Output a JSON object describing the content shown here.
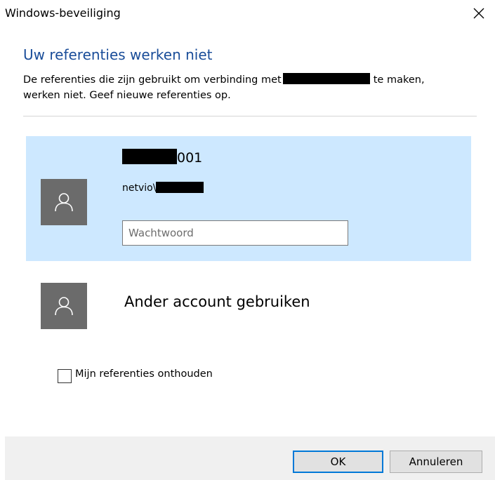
{
  "window": {
    "title": "Windows-beveiliging",
    "close_icon": "close-icon"
  },
  "header": {
    "heading": "Uw referenties werken niet",
    "desc_part1": "De referenties die zijn gebruikt om verbinding met",
    "desc_part2": "te maken, werken niet. Geef nieuwe referenties op."
  },
  "accounts": {
    "selected": {
      "name_suffix": "001",
      "user_prefix": "netvio\\",
      "password_placeholder": "Wachtwoord",
      "avatar_icon": "user-icon"
    },
    "other": {
      "label": "Ander account gebruiken",
      "avatar_icon": "user-icon"
    }
  },
  "remember": {
    "label": "Mijn referenties onthouden",
    "checked": false
  },
  "buttons": {
    "ok": "OK",
    "cancel": "Annuleren"
  },
  "colors": {
    "heading": "#1a4d99",
    "selected_bg": "#cde8ff",
    "avatar_bg": "#6b6b6b",
    "footer_bg": "#f0f0f0",
    "focus_border": "#0078d7"
  }
}
